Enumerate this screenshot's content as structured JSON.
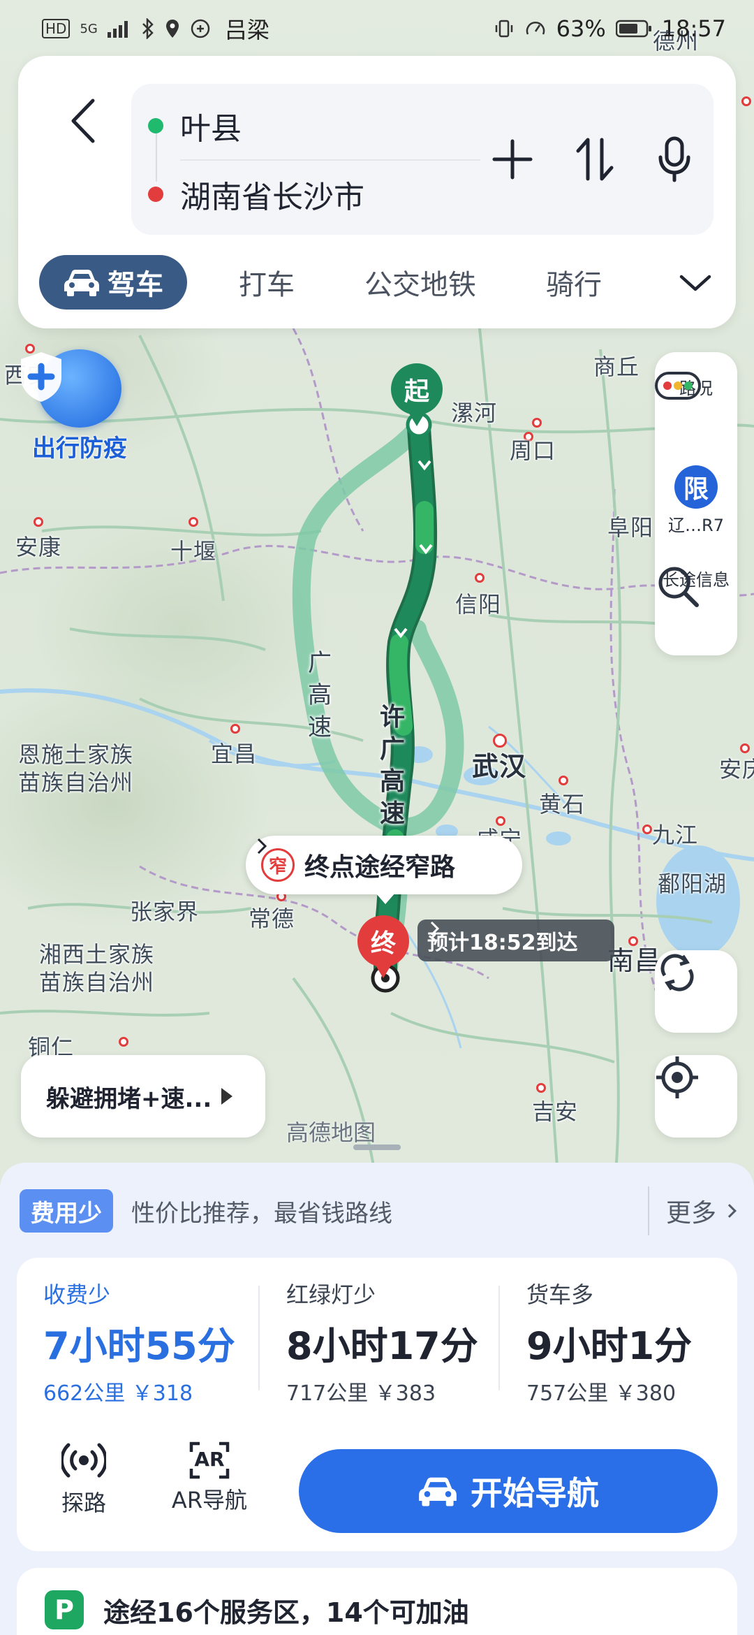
{
  "status_bar": {
    "left_icons": [
      "HD",
      "5G"
    ],
    "location_label": "吕梁",
    "battery": "63%",
    "time": "18:57"
  },
  "route": {
    "from": "叶县",
    "to": "湖南省长沙市",
    "from_dot_color": "#1fba6e",
    "to_dot_color": "#e23c3c"
  },
  "tools": {
    "add_icon": "plus-icon",
    "swap_icon": "swap-icon",
    "voice_icon": "microphone-icon"
  },
  "tabs": [
    {
      "label": "驾车",
      "active": true
    },
    {
      "label": "打车"
    },
    {
      "label": "公交地铁"
    },
    {
      "label": "骑行"
    }
  ],
  "map": {
    "epidemic_label": "出行防疫",
    "start_pin": "起",
    "end_pin": "终",
    "narrow_badge": "窄",
    "narrow_text": "终点途经窄路",
    "eta_text": "预计18:52到达",
    "road_main": [
      "许",
      "广",
      "高",
      "速"
    ],
    "road_alt": [
      "广",
      "高",
      "速"
    ],
    "logo": "高德地图",
    "cities": {
      "luohe": "漯河",
      "zhoukou": "周口",
      "shangqiu": "商丘",
      "fuyang": "阜阳",
      "xinyang": "信阳",
      "wuhan": "武汉",
      "huangshi": "黄石",
      "jiujiang": "九江",
      "poyanghu": "鄱阳湖",
      "nanchang": "南昌",
      "jian": "吉安",
      "changde": "常德",
      "zhangjiajie": "张家界",
      "yichang": "宜昌",
      "shiyan": "十堰",
      "ankang": "安康",
      "xian": "西安",
      "enshi_1": "恩施土家族",
      "enshi_2": "苗族自治州",
      "xiangxi_1": "湘西土家族",
      "xiangxi_2": "苗族自治州",
      "tongren": "铜仁",
      "dezhou": "德州",
      "anqing": "安庆",
      "xianning": "咸宁"
    },
    "colors": {
      "route_main": "#1e8a5c",
      "route_main_light": "#35b566",
      "route_alt": "#7ec9a6"
    }
  },
  "side_tools": {
    "traffic": "路况",
    "restrict_badge": "限",
    "restrict_label": "辽…R7",
    "longtrip_label": "长途信息"
  },
  "avoid_button": "躲避拥堵+速...",
  "preference": {
    "tag": "费用少",
    "desc": "性价比推荐，最省钱路线",
    "more": "更多"
  },
  "plans": [
    {
      "tag": "收费少",
      "time": "7小时55分",
      "meta": "662公里 ￥318",
      "selected": true
    },
    {
      "tag": "红绿灯少",
      "time": "8小时17分",
      "meta": "717公里 ￥383"
    },
    {
      "tag": "货车多",
      "time": "9小时1分",
      "meta": "757公里 ￥380"
    }
  ],
  "bottom_tools": {
    "probe": "探路",
    "ar_nav": "AR导航",
    "ar_badge": "AR"
  },
  "start_nav": "开始导航",
  "service": {
    "icon_letter": "P",
    "text": "途经16个服务区，14个可加油"
  }
}
